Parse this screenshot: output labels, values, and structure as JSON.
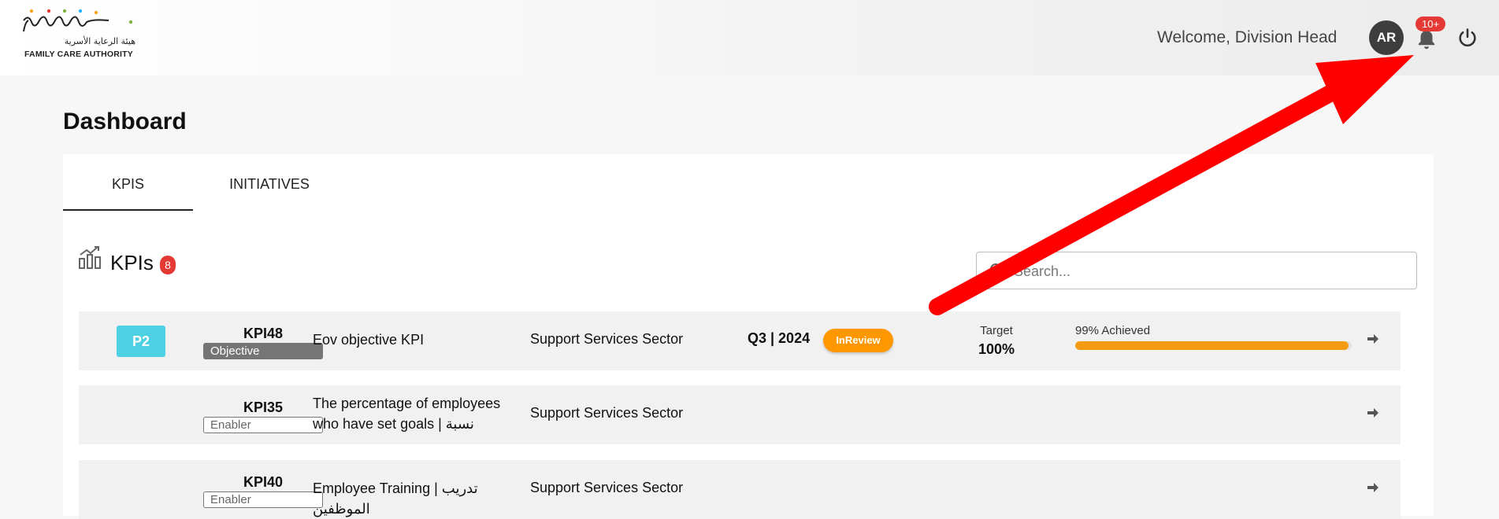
{
  "brand": {
    "name_ar": "هيئة الرعاية الأسرية",
    "name_en": "FAMILY CARE AUTHORITY",
    "logo_colors": [
      "#f5a623",
      "#e53935",
      "#7cb342",
      "#29b6f6"
    ]
  },
  "header": {
    "welcome": "Welcome,  Division Head",
    "avatar_initials": "AR",
    "notification_count": "10+",
    "icons": [
      "bell-icon",
      "power-icon"
    ]
  },
  "page": {
    "title": "Dashboard"
  },
  "tabs": [
    {
      "label": "KPIS",
      "active": true
    },
    {
      "label": "INITIATIVES",
      "active": false
    }
  ],
  "kpi_section": {
    "title": "KPIs",
    "count": "8",
    "search_placeholder": "Search..."
  },
  "kpis": [
    {
      "priority": "P2",
      "code": "KPI48",
      "type": "Objective",
      "name": "Eov objective KPI",
      "sector": "Support Services Sector",
      "period": "Q3 | 2024",
      "status": "InReview",
      "target_label": "Target",
      "target_value": "100%",
      "achieved_label": "99% Achieved",
      "achieved_fraction": 0.99
    },
    {
      "priority": "",
      "code": "KPI35",
      "type": "Enabler",
      "name": "The percentage of employees who have set goals | نسبة الموظفين...",
      "sector": "Support Services Sector"
    },
    {
      "priority": "",
      "code": "KPI40",
      "type": "Enabler",
      "name": "Employee Training | تدريب الموظفين",
      "sector": "Support Services Sector"
    }
  ],
  "colors": {
    "accent_orange": "#f59b13",
    "priority_cyan": "#4dd0e1",
    "badge_red": "#e53935",
    "annotation_arrow": "#ff0000"
  }
}
